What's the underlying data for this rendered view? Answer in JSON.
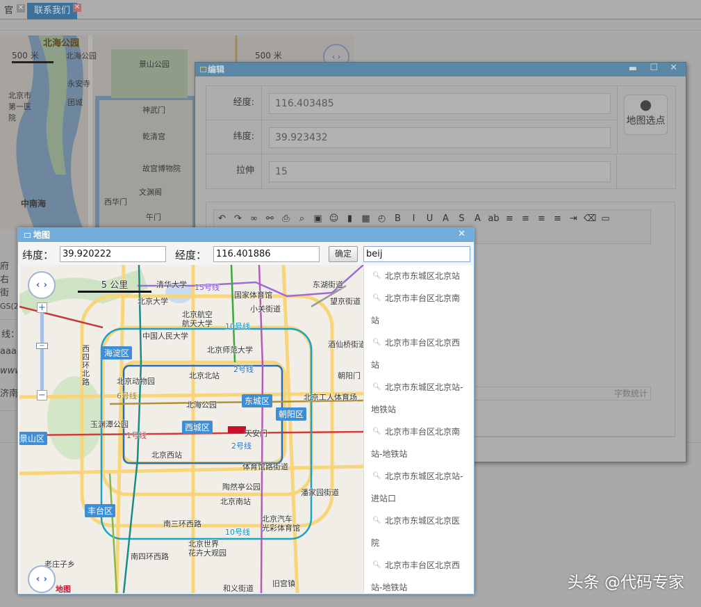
{
  "tabs": [
    {
      "label": "官"
    },
    {
      "label": "联系我们"
    }
  ],
  "bg_map": {
    "labels": [
      "北海公园",
      "北海公园",
      "景山公园",
      "永安寺",
      "团城",
      "神武门",
      "乾清宫",
      "故宫博物院",
      "文渊阁",
      "西华门",
      "午门",
      "中南海",
      "北京市第一医院",
      "500 米",
      "500 米"
    ]
  },
  "bg_form": {
    "fragments": [
      "府右街",
      "GS(2",
      "线：",
      "aaaa",
      "www.a",
      "济南市"
    ]
  },
  "edit_dialog": {
    "title": "编辑",
    "fields": [
      {
        "label": "经度:",
        "value": "116.403485"
      },
      {
        "label": "纬度:",
        "value": "39.923432"
      },
      {
        "label": "拉伸",
        "value": "15"
      }
    ],
    "map_pick_button": "地图选点",
    "word_count": "字数统计",
    "toolbar_icons": [
      "undo-icon",
      "redo-icon",
      "link-icon",
      "unlink-icon",
      "print-icon",
      "preview-icon",
      "image-icon",
      "emotion-icon",
      "video-icon",
      "date-icon",
      "time-icon",
      "bold-icon",
      "italic-icon",
      "underline-icon",
      "fontborder-icon",
      "strikethrough-icon",
      "forecolor-icon",
      "backcolor-icon",
      "align-left-icon",
      "align-center-icon",
      "align-right-icon",
      "justify-icon",
      "indent-icon",
      "eraser-icon",
      "fullscreen-icon"
    ]
  },
  "map_dialog": {
    "title": "地图",
    "lat_label": "纬度：",
    "lat_value": "39.920222",
    "lng_label": "经度：",
    "lng_value": "116.401886",
    "ok_button": "确定",
    "search_value": "beij",
    "suggestions": [
      [
        "北京市东城区北京站"
      ],
      [
        "北京市丰台区北京南",
        "站"
      ],
      [
        "北京市丰台区北京西",
        "站"
      ],
      [
        "北京市东城区北京站-",
        "地铁站"
      ],
      [
        "北京市丰台区北京南",
        "站-地铁站"
      ],
      [
        "北京市东城区北京站-",
        "进站口"
      ],
      [
        "北京市东城区北京医",
        "院"
      ],
      [
        "北京市丰台区北京西",
        "站-地铁站"
      ]
    ],
    "map": {
      "scale": "5 公里",
      "logo": "地图",
      "labels": [
        "清华大学",
        "15号线",
        "东湖街道",
        "北京大学",
        "国家体育馆",
        "望京街道",
        "小关街道",
        "北京航空",
        "航天大学",
        "10号线",
        "中国人民大学",
        "酒仙桥街道",
        "北京师范大学",
        "2号线",
        "北京北站",
        "朝阳门",
        "北京动物园",
        "6号线",
        "北京工人体育场",
        "北海公园",
        "玉渊潭公园",
        "天安门",
        "1号线",
        "2号线",
        "北京西站",
        "体育馆路街道",
        "陶然亭公园",
        "潘家园街道",
        "北京南站",
        "南三环西路",
        "北京汽车",
        "光彩体育馆",
        "10号线",
        "北京世界",
        "花卉大观园",
        "南四环西路",
        "老庄子乡",
        "和义街道",
        "旧宫镇",
        "西四环北路",
        "北京南站"
      ],
      "districts": [
        "海淀区",
        "东城区",
        "朝阳区",
        "西城区",
        "丰台区",
        "景山区"
      ]
    }
  },
  "watermark": "头条 @代码专家"
}
